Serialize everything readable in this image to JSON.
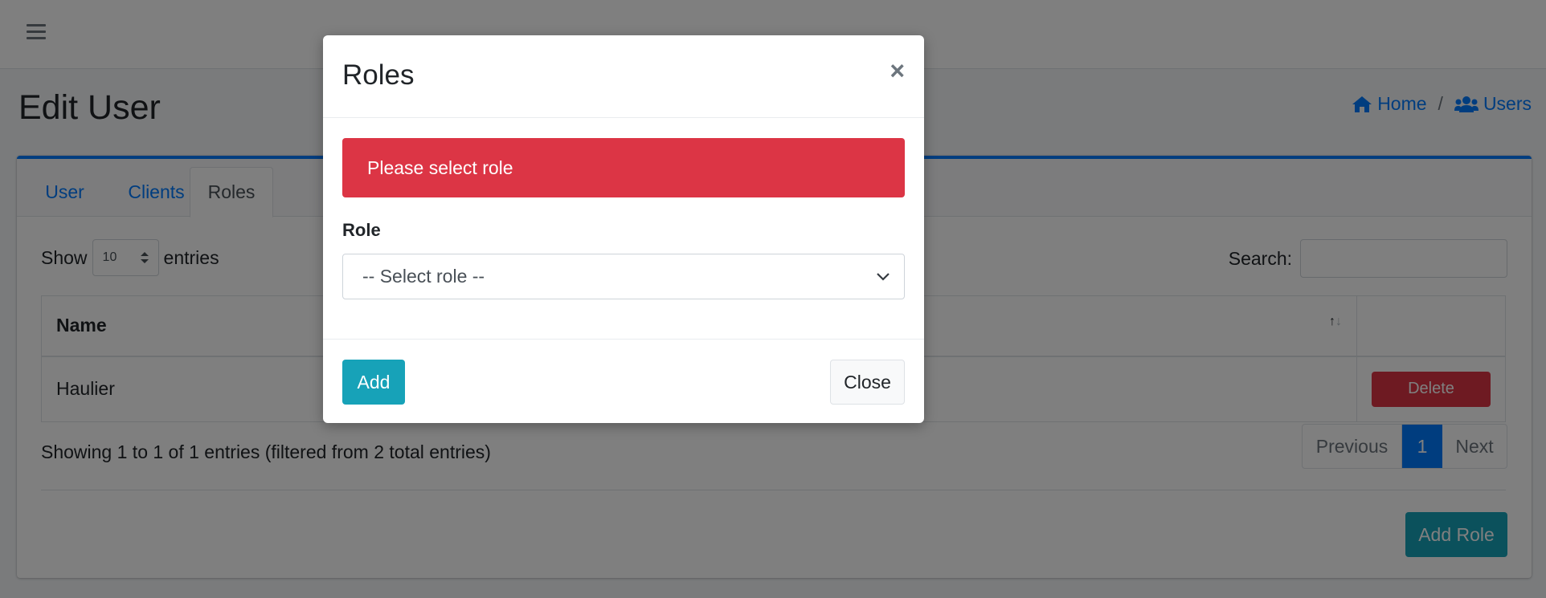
{
  "page": {
    "title": "Edit User"
  },
  "breadcrumb": {
    "home": "Home",
    "separator": "/",
    "users": "Users"
  },
  "tabs": [
    {
      "label": "User",
      "active": false
    },
    {
      "label": "Clients",
      "active": false
    },
    {
      "label": "Roles",
      "active": true
    }
  ],
  "table_controls": {
    "show_label": "Show",
    "entries_value": "10",
    "entries_label": "entries",
    "search_label": "Search:"
  },
  "table": {
    "columns": [
      "Name",
      ""
    ],
    "rows": [
      {
        "name": "Haulier",
        "action": "Delete"
      }
    ],
    "info": "Showing 1 to 1 of 1 entries (filtered from 2 total entries)"
  },
  "pagination": {
    "previous": "Previous",
    "current": "1",
    "next": "Next"
  },
  "add_role_button": "Add Role",
  "modal": {
    "title": "Roles",
    "close_x": "×",
    "alert": "Please select role",
    "role_label": "Role",
    "role_select_value": "-- Select role --",
    "add_button": "Add",
    "close_button": "Close"
  },
  "colors": {
    "primary": "#007bff",
    "danger": "#dc3545",
    "info": "#17a2b8"
  }
}
